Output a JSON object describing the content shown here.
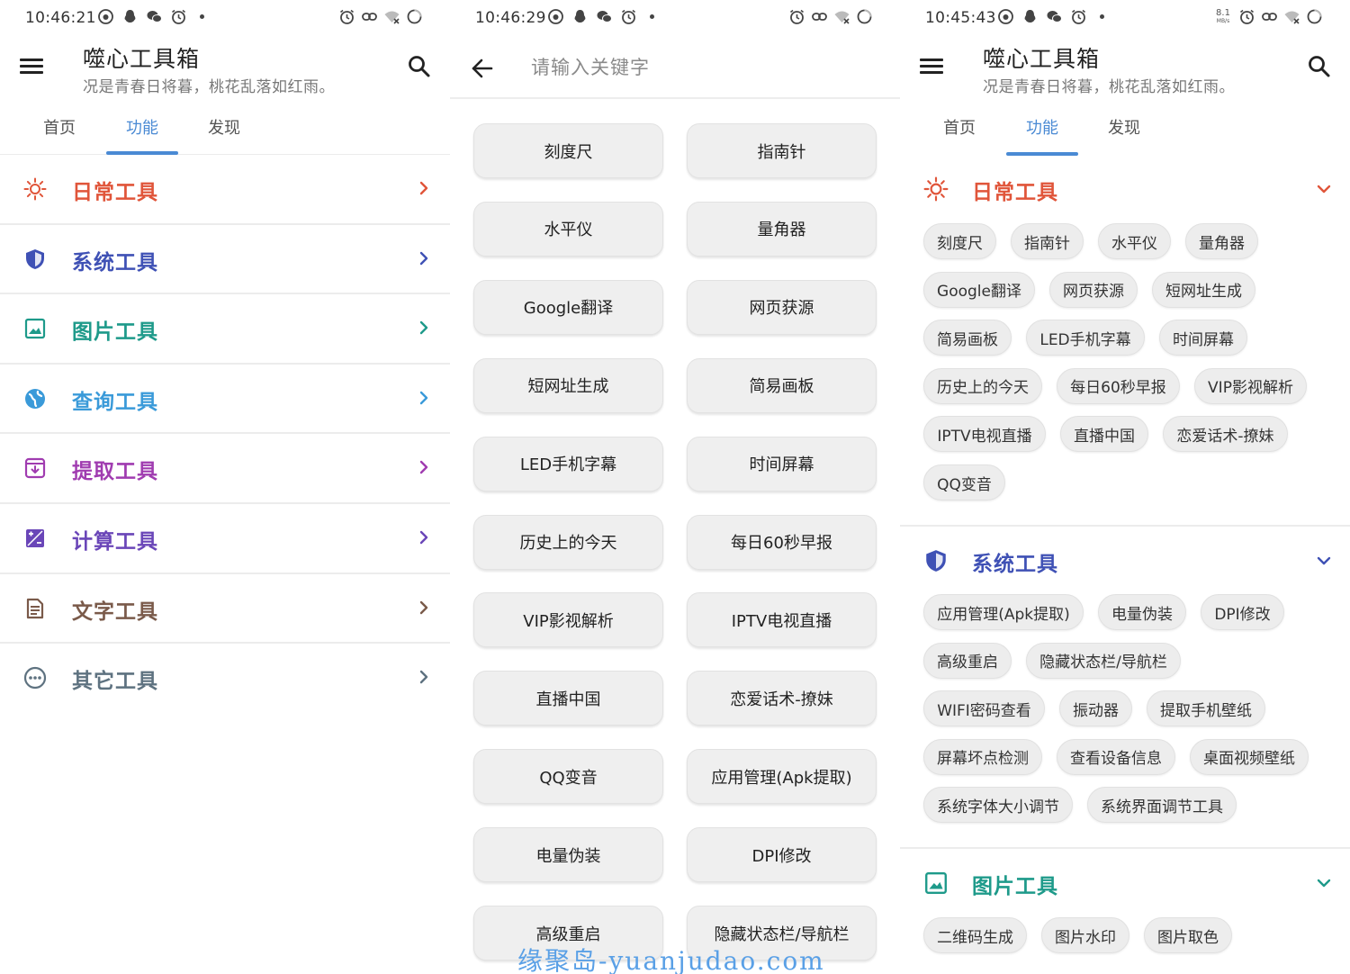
{
  "colors": {
    "accent": "#4a8ad4",
    "daily": "#e0553a",
    "system": "#3f51b5",
    "image": "#1e9a8a",
    "query": "#3a9ad9",
    "extract": "#a03cb0",
    "calc": "#6a46b8",
    "text": "#7a5a4a",
    "other": "#5e7280"
  },
  "left": {
    "status": {
      "time": "10:46:21"
    },
    "app_title": "噬心工具箱",
    "app_subtitle": "况是青春日将暮，桃花乱落如红雨。",
    "tabs": [
      "首页",
      "功能",
      "发现"
    ],
    "categories": [
      {
        "label": "日常工具",
        "icon": "sun-icon",
        "color": "#e0553a"
      },
      {
        "label": "系统工具",
        "icon": "shield-icon",
        "color": "#3f51b5"
      },
      {
        "label": "图片工具",
        "icon": "image-icon",
        "color": "#1e9a8a"
      },
      {
        "label": "查询工具",
        "icon": "globe-icon",
        "color": "#3a9ad9"
      },
      {
        "label": "提取工具",
        "icon": "archive-icon",
        "color": "#a03cb0"
      },
      {
        "label": "计算工具",
        "icon": "calculator-icon",
        "color": "#6a46b8"
      },
      {
        "label": "文字工具",
        "icon": "document-icon",
        "color": "#7a5a4a"
      },
      {
        "label": "其它工具",
        "icon": "more-icon",
        "color": "#5e7280"
      }
    ]
  },
  "middle": {
    "status": {
      "time": "10:46:29"
    },
    "search_placeholder": "请输入关键字",
    "buttons": [
      "刻度尺",
      "指南针",
      "水平仪",
      "量角器",
      "Google翻译",
      "网页获源",
      "短网址生成",
      "简易画板",
      "LED手机字幕",
      "时间屏幕",
      "历史上的今天",
      "每日60秒早报",
      "VIP影视解析",
      "IPTV电视直播",
      "直播中国",
      "恋爱话术-撩妹",
      "QQ变音",
      "应用管理(Apk提取)",
      "电量伪装",
      "DPI修改",
      "高级重启",
      "隐藏状态栏/导航栏"
    ]
  },
  "right": {
    "status": {
      "time": "10:45:43",
      "speed_value": "8.1",
      "speed_unit": "MB/s"
    },
    "app_title": "噬心工具箱",
    "app_subtitle": "况是青春日将暮，桃花乱落如红雨。",
    "tabs": [
      "首页",
      "功能",
      "发现"
    ],
    "sections": [
      {
        "label": "日常工具",
        "icon": "sun-icon",
        "color": "#e0553a",
        "chips": [
          [
            "刻度尺",
            "指南针",
            "水平仪",
            "量角器"
          ],
          [
            "Google翻译",
            "网页获源",
            "短网址生成"
          ],
          [
            "简易画板",
            "LED手机字幕",
            "时间屏幕"
          ],
          [
            "历史上的今天",
            "每日60秒早报",
            "VIP影视解析"
          ],
          [
            "IPTV电视直播",
            "直播中国",
            "恋爱话术-撩妹"
          ],
          [
            "QQ变音"
          ]
        ]
      },
      {
        "label": "系统工具",
        "icon": "shield-icon",
        "color": "#3f51b5",
        "chips": [
          [
            "应用管理(Apk提取)",
            "电量伪装",
            "DPI修改"
          ],
          [
            "高级重启",
            "隐藏状态栏/导航栏"
          ],
          [
            "WIFI密码查看",
            "振动器",
            "提取手机壁纸"
          ],
          [
            "屏幕坏点检测",
            "查看设备信息",
            "桌面视频壁纸"
          ],
          [
            "系统字体大小调节",
            "系统界面调节工具"
          ]
        ]
      },
      {
        "label": "图片工具",
        "icon": "image-icon",
        "color": "#1e9a8a",
        "chips": [
          [
            "二维码生成",
            "图片水印",
            "图片取色"
          ]
        ]
      }
    ]
  },
  "watermark": "缘聚岛-yuanjudao.com"
}
